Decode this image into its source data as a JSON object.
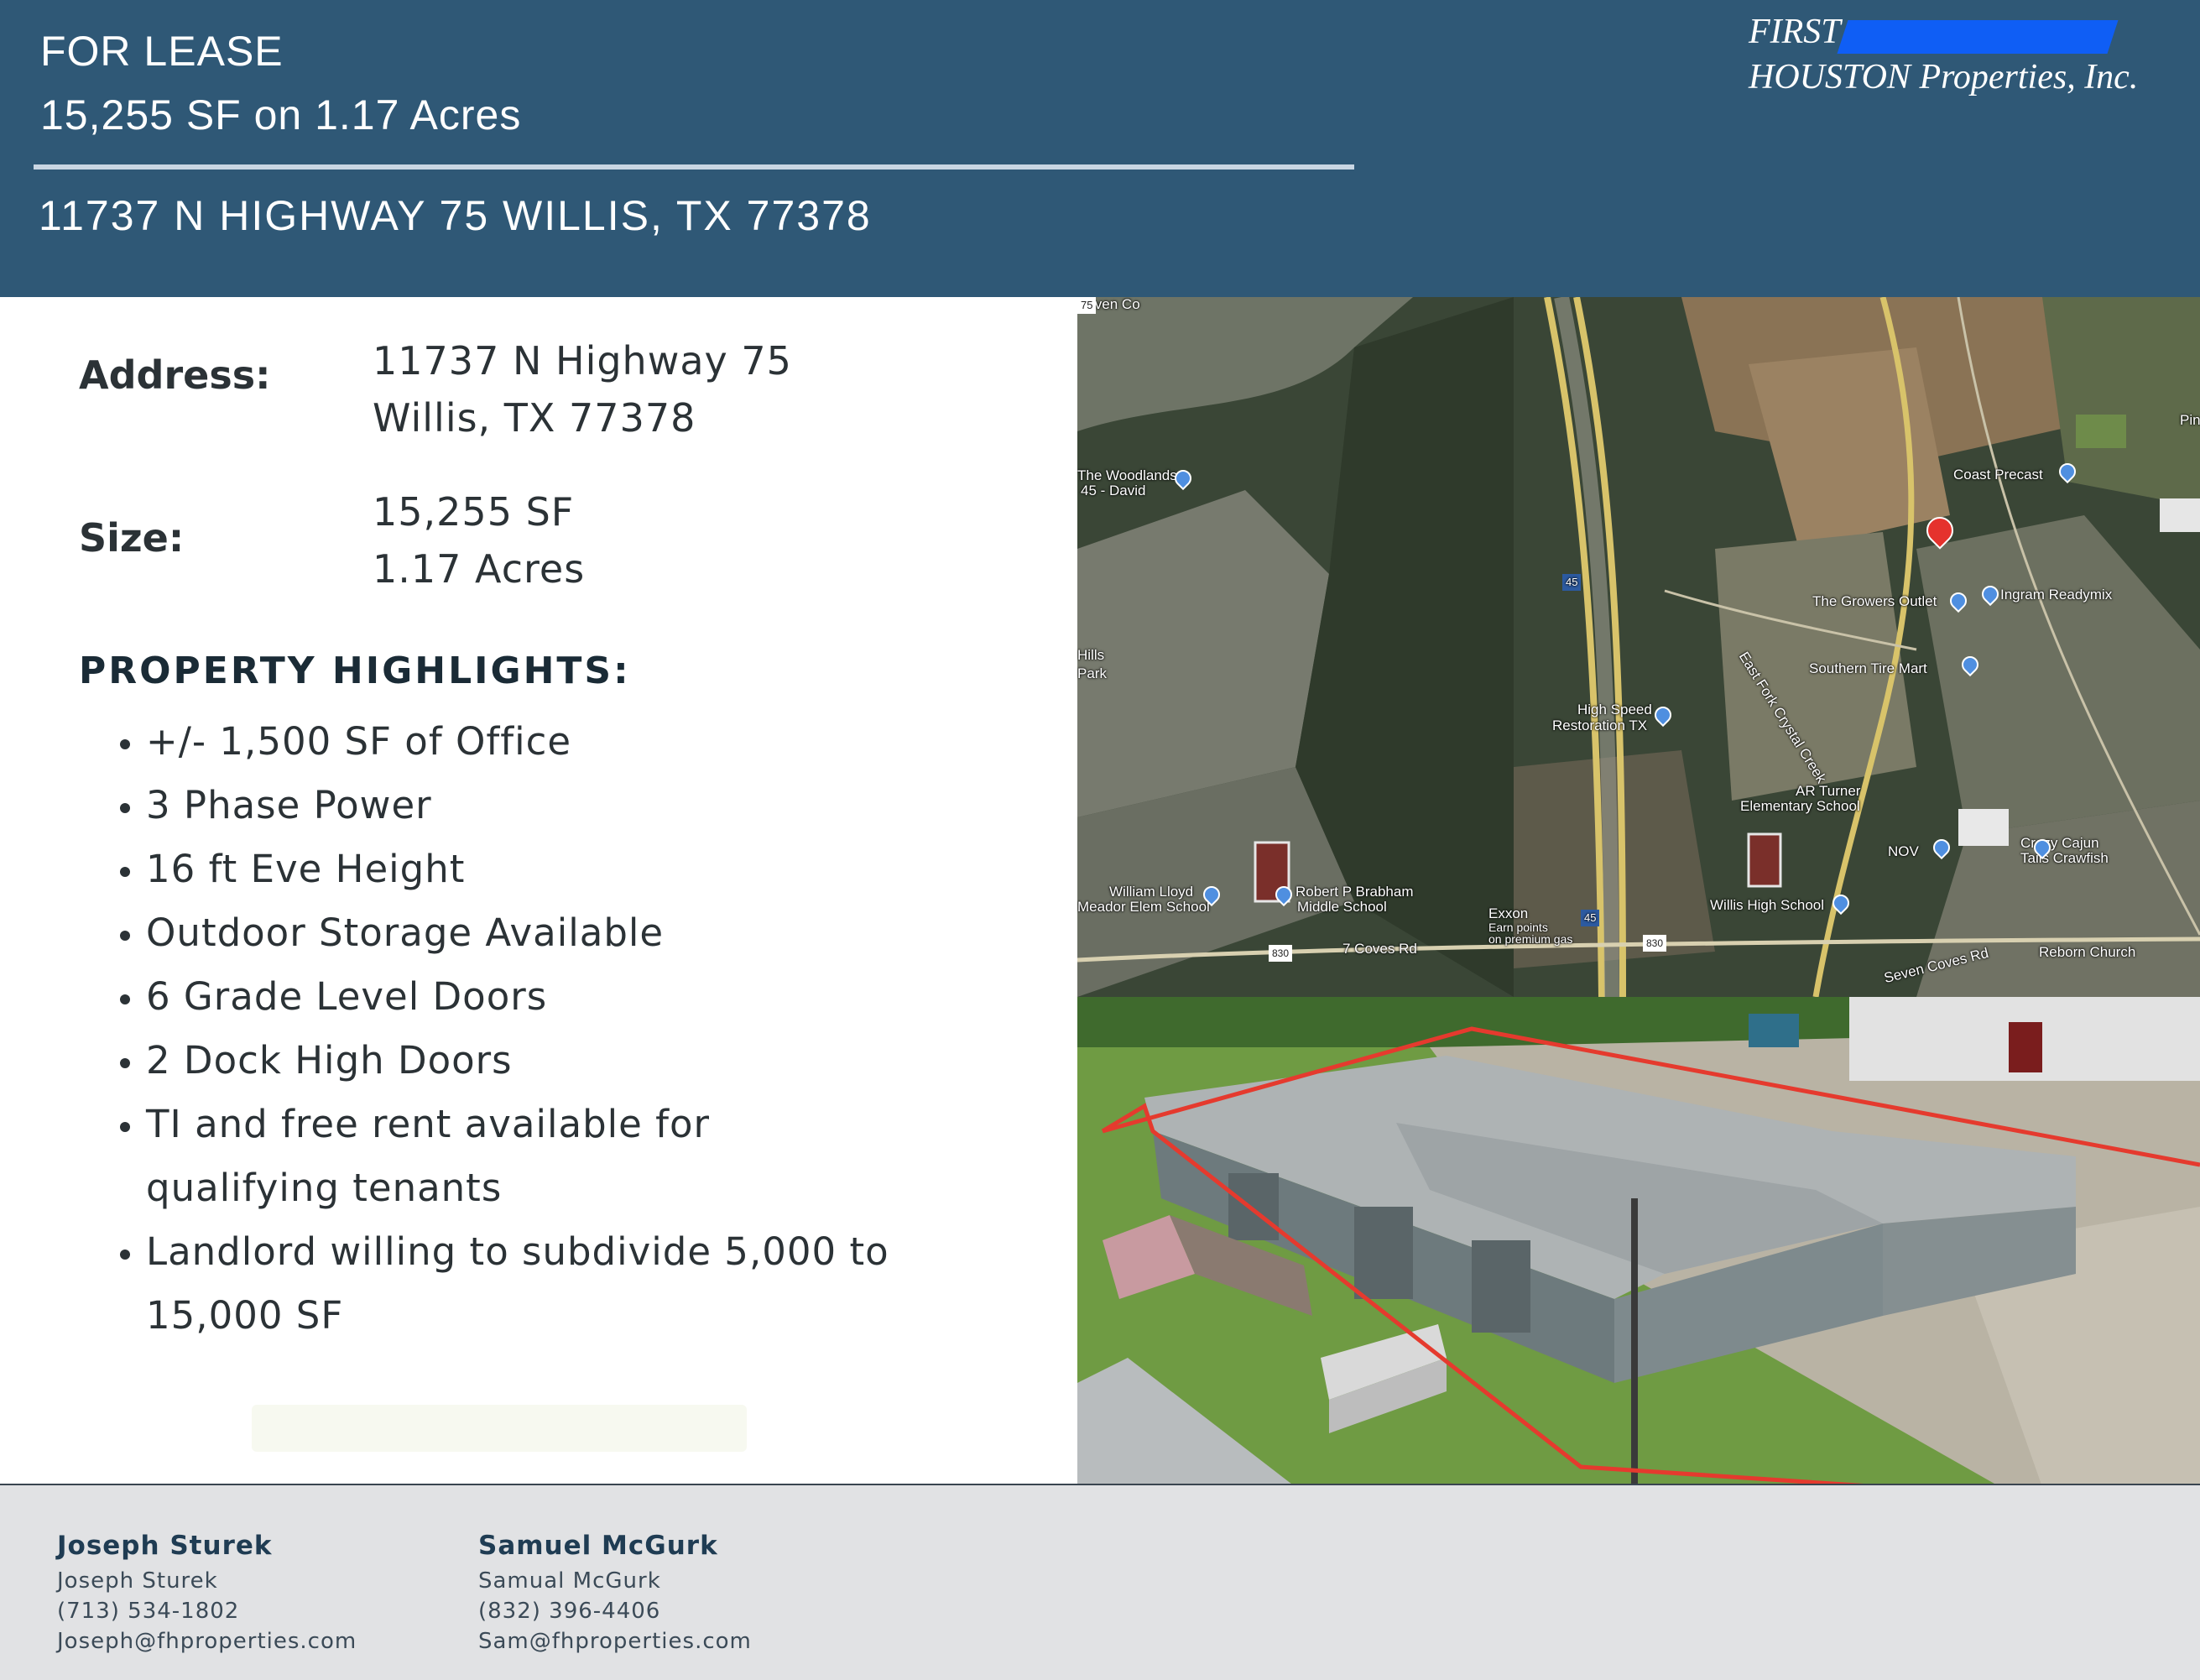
{
  "header": {
    "status": "FOR LEASE",
    "size_line": "15,255 SF on 1.17 Acres",
    "address": "11737 N HIGHWAY 75 WILLIS, TX 77378",
    "logo_first": "FIRST",
    "logo_name": "HOUSTON Properties, Inc.",
    "brand_color": "#2f5876",
    "logo_accent": "#0f5ef5"
  },
  "details": {
    "address_label": "Address:",
    "address_line1": "11737 N Highway 75",
    "address_line2": "Willis, TX 77378",
    "size_label": "Size:",
    "size_line1": "15,255 SF",
    "size_line2": "1.17 Acres"
  },
  "highlights": {
    "title": "PROPERTY HIGHLIGHTS:",
    "items": [
      "+/- 1,500 SF of Office",
      "3 Phase Power",
      "16 ft Eve Height",
      "Outdoor Storage Available",
      "6 Grade Level Doors",
      "2 Dock High Doors",
      "TI and free rent available for qualifying tenants",
      "Landlord willing to subdivide 5,000 to 15,000 SF"
    ]
  },
  "map": {
    "labels": {
      "woodlands": "The Woodlands",
      "woodlands2": "45 - David",
      "coast_precast": "Coast Precast",
      "growers": "The Growers Outlet",
      "ingram": "Ingram Readymix",
      "southern": "Southern Tire Mart",
      "high_speed": "High Speed",
      "restoration": "Restoration TX",
      "creek": "East Fork Crystal Creek",
      "ar_turner": "AR Turner",
      "elem": "Elementary School",
      "crazy_cajun": "Crazy Cajun",
      "tails": "Tails Crawfish",
      "nov": "NOV",
      "william_lloyd": "William Lloyd",
      "meador": "Meador Elem School",
      "brabham": "Robert P Brabham",
      "brabham2": "Middle School",
      "exxon": "Exxon",
      "exxon2": "Earn points",
      "exxon3": "on premium gas",
      "willis_high": "Willis High School",
      "seven_coves": "7 Coves Rd",
      "seven_coves2": "Seven Coves Rd",
      "reborn": "Reborn Church",
      "pine": "Pine Circ",
      "seven_cov": "Seven Co",
      "hills": "Hills",
      "park": "Park",
      "hw45": "45",
      "hw75": "75",
      "fm830": "830"
    }
  },
  "agents": [
    {
      "name": "Joseph Sturek",
      "subname": "Joseph Sturek",
      "phone": "(713) 534-1802",
      "email": "Joseph@fhproperties.com"
    },
    {
      "name": "Samuel McGurk",
      "subname": "Samual McGurk",
      "phone": "(832) 396-4406",
      "email": "Sam@fhproperties.com"
    }
  ]
}
